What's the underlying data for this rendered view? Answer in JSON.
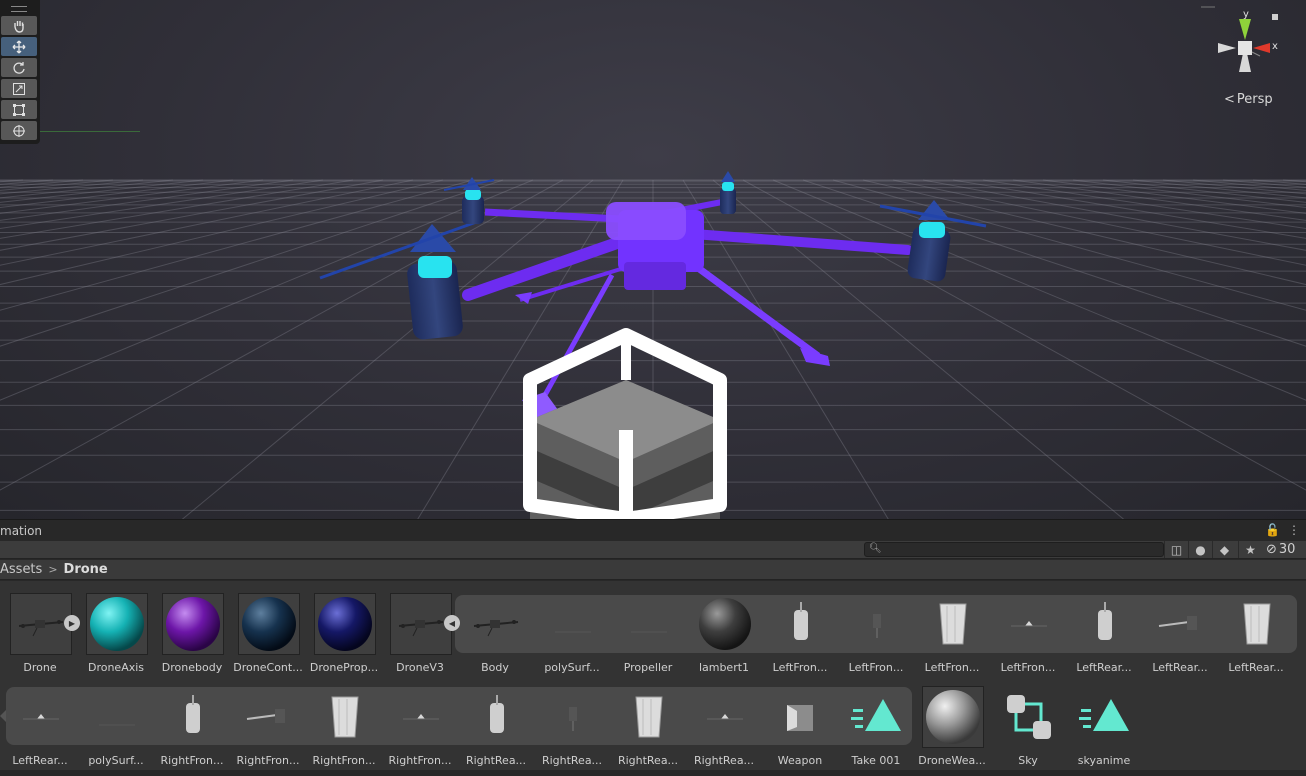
{
  "scene": {
    "persp_label": "Persp",
    "axis_labels": {
      "y": "y",
      "x": "x"
    },
    "tools": [
      {
        "name": "hand-tool",
        "icon": "hand-icon"
      },
      {
        "name": "move-tool",
        "icon": "move-icon",
        "active": true
      },
      {
        "name": "rotate-tool",
        "icon": "rotate-icon"
      },
      {
        "name": "scale-tool",
        "icon": "scale-icon"
      },
      {
        "name": "rect-tool",
        "icon": "rect-icon"
      },
      {
        "name": "transform-tool",
        "icon": "transform-icon"
      }
    ],
    "colors": {
      "accent": "#7a3cff",
      "glow": "#22ddee",
      "gizmo_y": "#8fd33a",
      "gizmo_x": "#e0392b"
    }
  },
  "panel": {
    "tab_label": "mation",
    "hidden_count": "30",
    "breadcrumb": {
      "root": "Assets",
      "current": "Drone"
    }
  },
  "assets": {
    "row1": [
      "Drone",
      "DroneAxis",
      "Dronebody",
      "DroneCont...",
      "DroneProp...",
      "DroneV3",
      "Body",
      "polySurf...",
      "Propeller",
      "lambert1",
      "LeftFron...",
      "LeftFron...",
      "LeftFron...",
      "LeftFron...",
      "LeftRear...",
      "LeftRear...",
      "LeftRear..."
    ],
    "row2": [
      "LeftRear...",
      "polySurf...",
      "RightFron...",
      "RightFron...",
      "RightFron...",
      "RightFron...",
      "RightRea...",
      "RightRea...",
      "RightRea...",
      "RightRea...",
      "Weapon",
      "Take 001",
      "DroneWea...",
      "Sky",
      "skyanime"
    ]
  }
}
